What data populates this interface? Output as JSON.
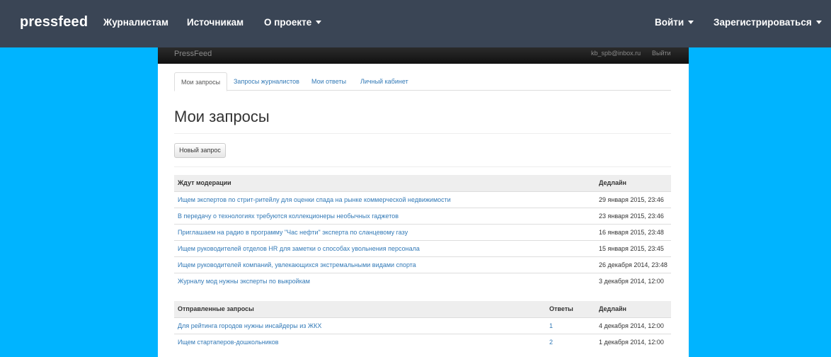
{
  "topnav": {
    "brand": "pressfeed",
    "journalists": "Журналистам",
    "sources": "Источникам",
    "about": "О проекте",
    "login": "Войти",
    "register": "Зарегистрироваться"
  },
  "inner": {
    "brand": "PressFeed",
    "email": "kb_spb@inbox.ru",
    "logout": "Выйти"
  },
  "tabs": [
    "Мои запросы",
    "Запросы журналистов",
    "Мои ответы",
    "Личный кабинет"
  ],
  "heading": "Мои запросы",
  "new_request": "Новый запрос",
  "moderation": {
    "headers": {
      "title": "Ждут модерации",
      "deadline": "Дедлайн"
    },
    "rows": [
      {
        "title": "Ищем экспертов по стрит-ритейлу для оценки спада на рынке коммерческой недвижимости",
        "deadline": "29 января 2015, 23:46"
      },
      {
        "title": "В передачу о технологиях требуются коллекционеры необычных гаджетов",
        "deadline": "23 января 2015, 23:46"
      },
      {
        "title": "Приглашаем на радио в программу \"Час нефти\" эксперта по сланцевому газу",
        "deadline": "16 января 2015, 23:48"
      },
      {
        "title": "Ищем руководителей отделов HR для заметки о способах увольнения персонала",
        "deadline": "15 января 2015, 23:45"
      },
      {
        "title": "Ищем руководителей компаний, увлекающихся экстремальными видами спорта",
        "deadline": "26 декабря 2014, 23:48"
      },
      {
        "title": "Журналу мод нужны эксперты по выкройкам",
        "deadline": "3 декабря 2014, 12:00"
      }
    ]
  },
  "sent": {
    "headers": {
      "title": "Отправленные запросы",
      "answers": "Ответы",
      "deadline": "Дедлайн"
    },
    "rows": [
      {
        "title": "Для рейтинга городов нужны инсайдеры из ЖКХ",
        "answers": "1",
        "deadline": "4 декабря 2014, 12:00"
      },
      {
        "title": "Ищем стартаперов-дошкольников",
        "answers": "2",
        "deadline": "1 декабря 2014, 12:00"
      }
    ]
  }
}
